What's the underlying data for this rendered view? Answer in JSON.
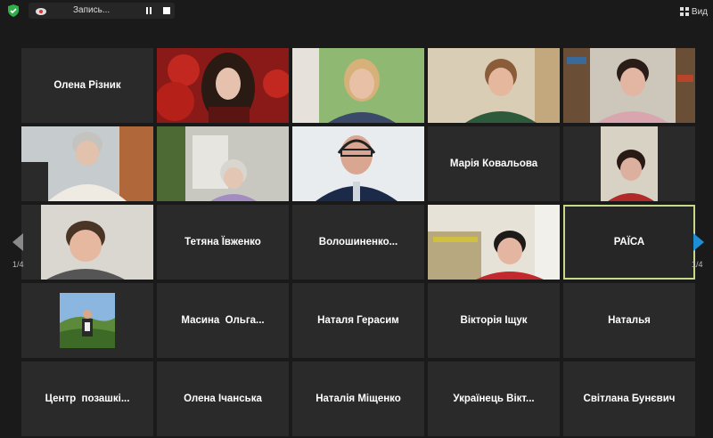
{
  "topbar": {
    "recording_label": "Запись...",
    "view_label": "Вид"
  },
  "participants": [
    {
      "name": "Олена Різник",
      "video": false
    },
    {
      "name": "",
      "video": true
    },
    {
      "name": "",
      "video": true
    },
    {
      "name": "",
      "video": true
    },
    {
      "name": "",
      "video": true
    },
    {
      "name": "",
      "video": true
    },
    {
      "name": "",
      "video": true
    },
    {
      "name": "",
      "video": true
    },
    {
      "name": "Марія Ковальова",
      "video": false
    },
    {
      "name": "",
      "video": true
    },
    {
      "name": "",
      "video": true
    },
    {
      "name": "Тетяна Ївженко",
      "video": false
    },
    {
      "name": "Волошиненко...",
      "video": false
    },
    {
      "name": "",
      "video": true
    },
    {
      "name": "РАЇСА",
      "video": false,
      "active": true
    },
    {
      "name": "",
      "video": false,
      "avatar": true
    },
    {
      "name": "Масина  Ольга...",
      "video": false
    },
    {
      "name": "Наталя Герасим",
      "video": false
    },
    {
      "name": "Вікторія Іщук",
      "video": false
    },
    {
      "name": "Наталья",
      "video": false
    },
    {
      "name": "Центр  позашкі...",
      "video": false
    },
    {
      "name": "Олена Ічанська",
      "video": false
    },
    {
      "name": "Наталія Міщенко",
      "video": false
    },
    {
      "name": "Українець Вікт...",
      "video": false
    },
    {
      "name": "Світлана Бунєвич",
      "video": false
    }
  ],
  "pagination": {
    "left_label": "1/4",
    "right_label": "1/4"
  },
  "colors": {
    "active_outline": "#c6d98a",
    "nav_right": "#1e8fd6",
    "shield": "#2fb04a"
  }
}
